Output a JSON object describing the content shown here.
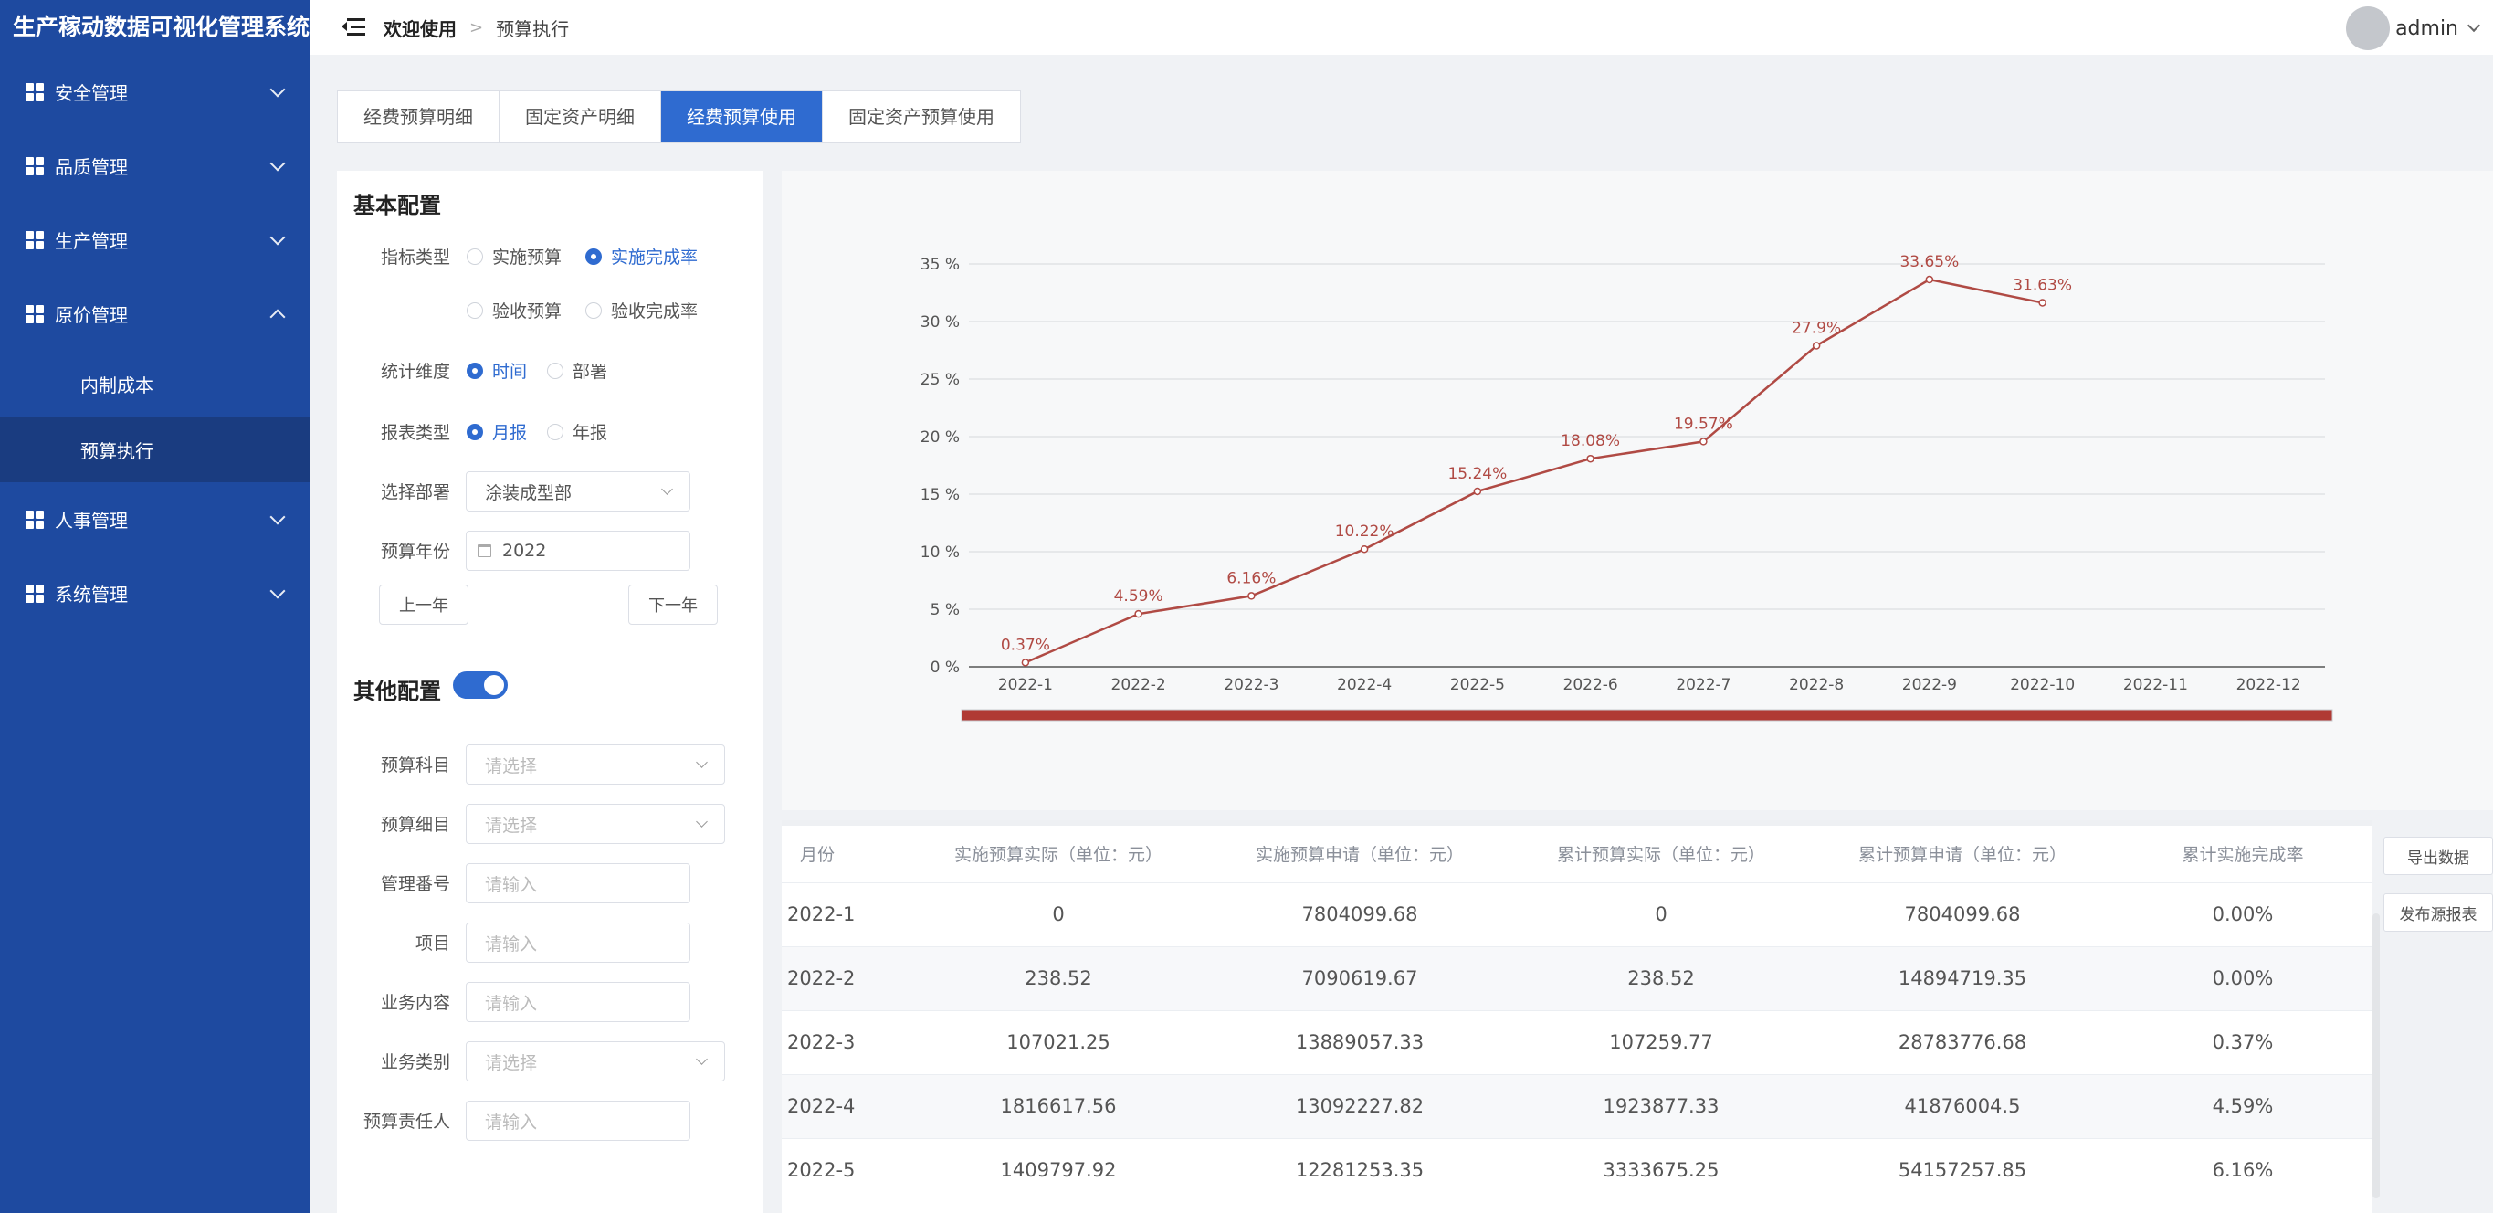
{
  "app": {
    "title": "生产稼动数据可视化管理系统"
  },
  "sidebar": {
    "items": [
      {
        "label": "安全管理"
      },
      {
        "label": "品质管理"
      },
      {
        "label": "生产管理"
      },
      {
        "label": "原价管理",
        "expanded": true,
        "children": [
          {
            "label": "内制成本"
          },
          {
            "label": "预算执行",
            "active": true
          }
        ]
      },
      {
        "label": "人事管理"
      },
      {
        "label": "系统管理"
      }
    ]
  },
  "header": {
    "breadcrumb": [
      "欢迎使用",
      "预算执行"
    ],
    "user": "admin"
  },
  "tabs": [
    {
      "label": "经费预算明细"
    },
    {
      "label": "固定资产明细"
    },
    {
      "label": "经费预算使用",
      "active": true
    },
    {
      "label": "固定资产预算使用"
    }
  ],
  "config": {
    "basic_title": "基本配置",
    "indicator": {
      "label": "指标类型",
      "options": [
        "实施预算",
        "实施完成率",
        "验收预算",
        "验收完成率"
      ],
      "selected": "实施完成率"
    },
    "dimension": {
      "label": "统计维度",
      "options": [
        "时间",
        "部署"
      ],
      "selected": "时间"
    },
    "report": {
      "label": "报表类型",
      "options": [
        "月报",
        "年报"
      ],
      "selected": "月报"
    },
    "department": {
      "label": "选择部署",
      "value": "涂装成型部"
    },
    "year": {
      "label": "预算年份",
      "value": "2022"
    },
    "prev_year": "上一年",
    "next_year": "下一年",
    "other_title": "其他配置",
    "other_enabled": true,
    "fields": [
      {
        "label": "预算科目",
        "type": "select",
        "placeholder": "请选择"
      },
      {
        "label": "预算细目",
        "type": "select",
        "placeholder": "请选择"
      },
      {
        "label": "管理番号",
        "type": "input",
        "placeholder": "请输入"
      },
      {
        "label": "项目",
        "type": "input",
        "placeholder": "请输入"
      },
      {
        "label": "业务内容",
        "type": "input",
        "placeholder": "请输入"
      },
      {
        "label": "业务类别",
        "type": "select",
        "placeholder": "请选择"
      },
      {
        "label": "预算责任人",
        "type": "input",
        "placeholder": "请输入"
      }
    ]
  },
  "chart_data": {
    "type": "line",
    "categories": [
      "2022-1",
      "2022-2",
      "2022-3",
      "2022-4",
      "2022-5",
      "2022-6",
      "2022-7",
      "2022-8",
      "2022-9",
      "2022-10",
      "2022-11",
      "2022-12"
    ],
    "values": [
      0.37,
      4.59,
      6.16,
      10.22,
      15.24,
      18.08,
      19.57,
      27.9,
      33.65,
      31.63,
      null,
      null
    ],
    "data_labels": [
      "0.37%",
      "4.59%",
      "6.16%",
      "10.22%",
      "15.24%",
      "18.08%",
      "19.57%",
      "27.9%",
      "33.65%",
      "31.63%"
    ],
    "y_ticks": [
      0,
      5,
      10,
      15,
      20,
      25,
      30,
      35
    ],
    "y_tick_labels": [
      "0 %",
      "5 %",
      "10 %",
      "15 %",
      "20 %",
      "25 %",
      "30 %",
      "35 %"
    ],
    "ylim": [
      0,
      35
    ],
    "grid": true,
    "line_color": "#b04a44",
    "zoom_bar_color": "#b03a34"
  },
  "table": {
    "columns": [
      "月份",
      "实施预算实际（单位：元）",
      "实施预算申请（单位：元）",
      "累计预算实际（单位：元）",
      "累计预算申请（单位：元）",
      "累计实施完成率"
    ],
    "rows": [
      [
        "2022-1",
        "0",
        "7804099.68",
        "0",
        "7804099.68",
        "0.00%"
      ],
      [
        "2022-2",
        "238.52",
        "7090619.67",
        "238.52",
        "14894719.35",
        "0.00%"
      ],
      [
        "2022-3",
        "107021.25",
        "13889057.33",
        "107259.77",
        "28783776.68",
        "0.37%"
      ],
      [
        "2022-4",
        "1816617.56",
        "13092227.82",
        "1923877.33",
        "41876004.5",
        "4.59%"
      ],
      [
        "2022-5",
        "1409797.92",
        "12281253.35",
        "3333675.25",
        "54157257.85",
        "6.16%"
      ]
    ]
  },
  "actions": {
    "export": "导出数据",
    "publish": "发布源报表"
  },
  "colors": {
    "sidebar": "#1e4aa0",
    "accent": "#2f6bd0"
  }
}
